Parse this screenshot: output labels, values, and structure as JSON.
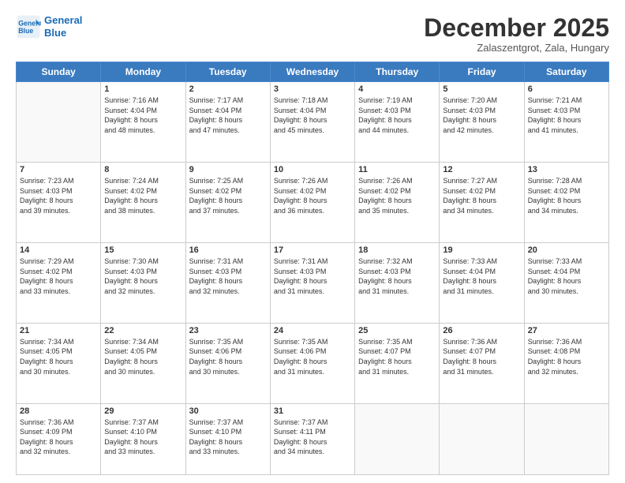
{
  "logo": {
    "line1": "General",
    "line2": "Blue"
  },
  "title": "December 2025",
  "location": "Zalaszentgrot, Zala, Hungary",
  "weekdays": [
    "Sunday",
    "Monday",
    "Tuesday",
    "Wednesday",
    "Thursday",
    "Friday",
    "Saturday"
  ],
  "weeks": [
    [
      {
        "num": "",
        "info": ""
      },
      {
        "num": "1",
        "info": "Sunrise: 7:16 AM\nSunset: 4:04 PM\nDaylight: 8 hours\nand 48 minutes."
      },
      {
        "num": "2",
        "info": "Sunrise: 7:17 AM\nSunset: 4:04 PM\nDaylight: 8 hours\nand 47 minutes."
      },
      {
        "num": "3",
        "info": "Sunrise: 7:18 AM\nSunset: 4:04 PM\nDaylight: 8 hours\nand 45 minutes."
      },
      {
        "num": "4",
        "info": "Sunrise: 7:19 AM\nSunset: 4:03 PM\nDaylight: 8 hours\nand 44 minutes."
      },
      {
        "num": "5",
        "info": "Sunrise: 7:20 AM\nSunset: 4:03 PM\nDaylight: 8 hours\nand 42 minutes."
      },
      {
        "num": "6",
        "info": "Sunrise: 7:21 AM\nSunset: 4:03 PM\nDaylight: 8 hours\nand 41 minutes."
      }
    ],
    [
      {
        "num": "7",
        "info": "Sunrise: 7:23 AM\nSunset: 4:03 PM\nDaylight: 8 hours\nand 39 minutes."
      },
      {
        "num": "8",
        "info": "Sunrise: 7:24 AM\nSunset: 4:02 PM\nDaylight: 8 hours\nand 38 minutes."
      },
      {
        "num": "9",
        "info": "Sunrise: 7:25 AM\nSunset: 4:02 PM\nDaylight: 8 hours\nand 37 minutes."
      },
      {
        "num": "10",
        "info": "Sunrise: 7:26 AM\nSunset: 4:02 PM\nDaylight: 8 hours\nand 36 minutes."
      },
      {
        "num": "11",
        "info": "Sunrise: 7:26 AM\nSunset: 4:02 PM\nDaylight: 8 hours\nand 35 minutes."
      },
      {
        "num": "12",
        "info": "Sunrise: 7:27 AM\nSunset: 4:02 PM\nDaylight: 8 hours\nand 34 minutes."
      },
      {
        "num": "13",
        "info": "Sunrise: 7:28 AM\nSunset: 4:02 PM\nDaylight: 8 hours\nand 34 minutes."
      }
    ],
    [
      {
        "num": "14",
        "info": "Sunrise: 7:29 AM\nSunset: 4:02 PM\nDaylight: 8 hours\nand 33 minutes."
      },
      {
        "num": "15",
        "info": "Sunrise: 7:30 AM\nSunset: 4:03 PM\nDaylight: 8 hours\nand 32 minutes."
      },
      {
        "num": "16",
        "info": "Sunrise: 7:31 AM\nSunset: 4:03 PM\nDaylight: 8 hours\nand 32 minutes."
      },
      {
        "num": "17",
        "info": "Sunrise: 7:31 AM\nSunset: 4:03 PM\nDaylight: 8 hours\nand 31 minutes."
      },
      {
        "num": "18",
        "info": "Sunrise: 7:32 AM\nSunset: 4:03 PM\nDaylight: 8 hours\nand 31 minutes."
      },
      {
        "num": "19",
        "info": "Sunrise: 7:33 AM\nSunset: 4:04 PM\nDaylight: 8 hours\nand 31 minutes."
      },
      {
        "num": "20",
        "info": "Sunrise: 7:33 AM\nSunset: 4:04 PM\nDaylight: 8 hours\nand 30 minutes."
      }
    ],
    [
      {
        "num": "21",
        "info": "Sunrise: 7:34 AM\nSunset: 4:05 PM\nDaylight: 8 hours\nand 30 minutes."
      },
      {
        "num": "22",
        "info": "Sunrise: 7:34 AM\nSunset: 4:05 PM\nDaylight: 8 hours\nand 30 minutes."
      },
      {
        "num": "23",
        "info": "Sunrise: 7:35 AM\nSunset: 4:06 PM\nDaylight: 8 hours\nand 30 minutes."
      },
      {
        "num": "24",
        "info": "Sunrise: 7:35 AM\nSunset: 4:06 PM\nDaylight: 8 hours\nand 31 minutes."
      },
      {
        "num": "25",
        "info": "Sunrise: 7:35 AM\nSunset: 4:07 PM\nDaylight: 8 hours\nand 31 minutes."
      },
      {
        "num": "26",
        "info": "Sunrise: 7:36 AM\nSunset: 4:07 PM\nDaylight: 8 hours\nand 31 minutes."
      },
      {
        "num": "27",
        "info": "Sunrise: 7:36 AM\nSunset: 4:08 PM\nDaylight: 8 hours\nand 32 minutes."
      }
    ],
    [
      {
        "num": "28",
        "info": "Sunrise: 7:36 AM\nSunset: 4:09 PM\nDaylight: 8 hours\nand 32 minutes."
      },
      {
        "num": "29",
        "info": "Sunrise: 7:37 AM\nSunset: 4:10 PM\nDaylight: 8 hours\nand 33 minutes."
      },
      {
        "num": "30",
        "info": "Sunrise: 7:37 AM\nSunset: 4:10 PM\nDaylight: 8 hours\nand 33 minutes."
      },
      {
        "num": "31",
        "info": "Sunrise: 7:37 AM\nSunset: 4:11 PM\nDaylight: 8 hours\nand 34 minutes."
      },
      {
        "num": "",
        "info": ""
      },
      {
        "num": "",
        "info": ""
      },
      {
        "num": "",
        "info": ""
      }
    ]
  ]
}
